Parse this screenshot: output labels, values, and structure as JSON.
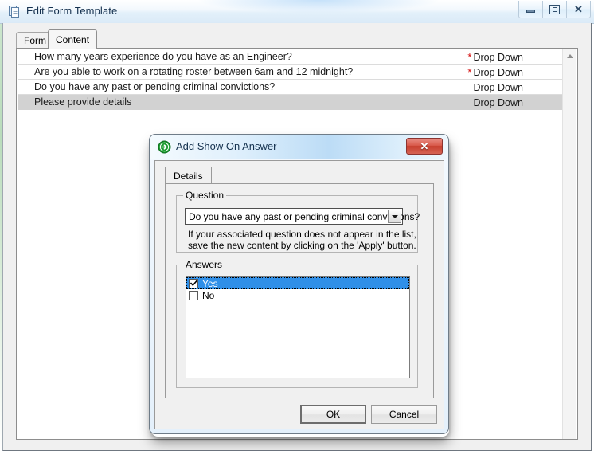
{
  "main_window": {
    "title": "Edit Form Template",
    "icon": "document-pages-icon",
    "caption_buttons": {
      "minimize_label": "Minimize",
      "maximize_label": "Maximize",
      "close_label": "Close",
      "close_glyph": "✕"
    },
    "tabs": [
      {
        "label": "Form",
        "active": false
      },
      {
        "label": "Content",
        "active": true
      }
    ]
  },
  "question_list": {
    "rows": [
      {
        "text": "How many years experience do you have as an Engineer?",
        "required": true,
        "star": "*",
        "type": "Drop Down",
        "selected": false
      },
      {
        "text": "Are you able to work on a rotating roster between 6am and 12 midnight?",
        "required": true,
        "star": "*",
        "type": "Drop Down",
        "selected": false
      },
      {
        "text": "Do you have any past or pending criminal convictions?",
        "required": false,
        "star": "",
        "type": "Drop Down",
        "selected": false
      },
      {
        "text": "Please provide details",
        "required": false,
        "star": "",
        "type": "Drop Down",
        "selected": true
      }
    ],
    "scrollbar": {
      "up_arrow": "scroll-up-arrow"
    }
  },
  "dialog": {
    "title": "Add Show On Answer",
    "icon": "green-arrow-circle-icon",
    "close_glyph": "✕",
    "tabs": [
      {
        "label": "Details",
        "active": true
      }
    ],
    "question_group": {
      "legend": "Question",
      "combo_value": "Do you have any past or pending criminal convictions?",
      "hint_line1": "If your associated question does not appear in the list,",
      "hint_line2": "save the new content by clicking on the 'Apply' button."
    },
    "answers_group": {
      "legend": "Answers",
      "items": [
        {
          "label": "Yes",
          "checked": true,
          "selected": true
        },
        {
          "label": "No",
          "checked": false,
          "selected": false
        }
      ]
    },
    "buttons": {
      "ok": "OK",
      "cancel": "Cancel"
    }
  },
  "colors": {
    "required_star": "#d20000",
    "selection_blue": "#2f8fe8",
    "row_selected_grey": "#d2d2d2",
    "close_red": "#c73f2e",
    "dialog_icon_green": "#17912b"
  }
}
